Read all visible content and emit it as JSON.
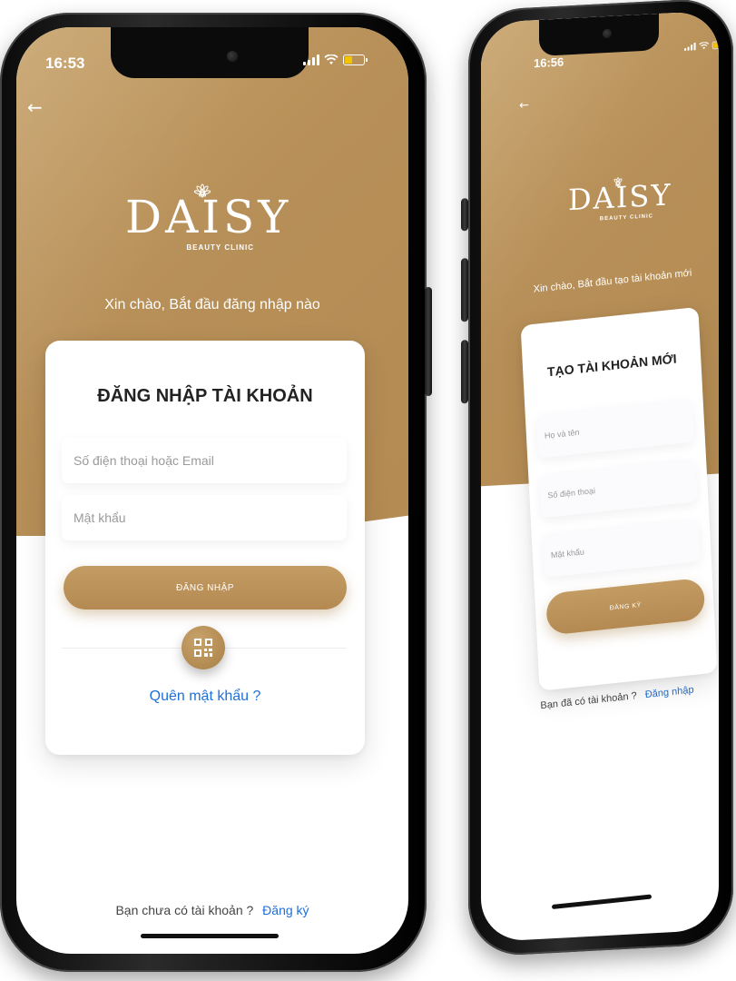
{
  "colors": {
    "brand_gold": "#b78f58",
    "link_blue": "#1e6fd8",
    "title_text": "#222222",
    "placeholder_text": "#9a9a9a"
  },
  "left_phone": {
    "status_time": "16:53",
    "back_icon": "back-arrow-icon",
    "logo_text": "DAISY",
    "logo_subtitle": "BEAUTY CLINIC",
    "greeting": "Xin chào, Bắt đầu đăng nhập nào",
    "card_title": "ĐĂNG NHẬP TÀI KHOẢN",
    "email_placeholder": "Số điện thoại hoặc Email",
    "password_placeholder": "Mật khẩu",
    "login_button": "ĐĂNG NHẬP",
    "qr_icon": "qr-code-icon",
    "forgot_password": "Quên mật khẩu ?",
    "no_account_text": "Bạn chưa có tài khoản ?",
    "register_link": "Đăng ký"
  },
  "right_phone": {
    "status_time": "16:56",
    "back_icon": "back-arrow-icon",
    "logo_text": "DAISY",
    "logo_subtitle": "BEAUTY CLINIC",
    "greeting": "Xin chào, Bắt đầu tạo tài khoản mới",
    "card_title": "TẠO TÀI KHOẢN MỚI",
    "name_placeholder": "Họ và tên",
    "phone_placeholder": "Số điện thoại",
    "password_placeholder": "Mật khẩu",
    "register_button": "ĐĂNG KÝ",
    "have_account_text": "Bạn đã có tài khoản ?",
    "login_link": "Đăng nhập"
  }
}
